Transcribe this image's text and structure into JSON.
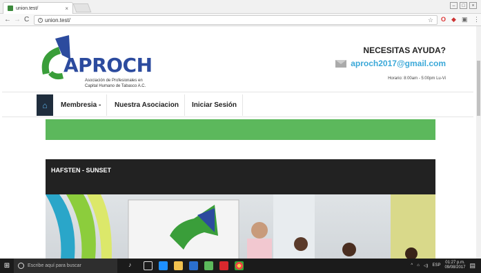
{
  "browser": {
    "tab_title": "union.test/",
    "tab_close": "×",
    "url": "union.test/",
    "window_controls": [
      "–",
      "□",
      "×"
    ]
  },
  "site": {
    "logo_name": "APROCH",
    "logo_sub_line1": "Asociación de Profesionales en",
    "logo_sub_line2": "Capital Humano de Tabasco A.C.",
    "help_title": "NECESITAS AYUDA?",
    "help_email": "aproch2017@gmail.com",
    "help_hours": "Horario: 8:00am - 5:00pm Lu-Vi",
    "nav": {
      "item_membresia": "Membresia -",
      "item_asociacion": "Nuestra Asociacion",
      "item_login": "Iniciar Sesión"
    },
    "card_title": "HAFSTEN - SUNSET"
  },
  "taskbar": {
    "search_placeholder": "Escribe aquí para buscar",
    "language": "ESP",
    "time": "01:27 p.m.",
    "date": "09/08/2017"
  },
  "colors": {
    "brand_blue": "#2c4b9e",
    "email_blue": "#3aa8d8",
    "green_bar": "#5cb85c",
    "nav_home_bg": "#1f2d3d",
    "card_header": "#222222"
  },
  "icons": [
    "home-icon",
    "mail-icon",
    "search-icon",
    "windows-start-icon"
  ]
}
